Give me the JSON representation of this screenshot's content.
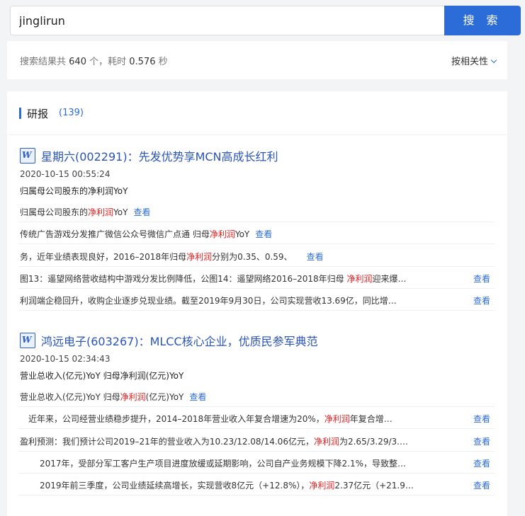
{
  "search": {
    "query": "jinglirun",
    "button_label": "搜 索"
  },
  "summary": {
    "prefix": "搜索结果共",
    "count": "640",
    "unit": "个，耗时",
    "time": "0.576",
    "time_unit": "秒",
    "sort_label": "按相关性"
  },
  "section": {
    "title": "研报",
    "count": "(139)"
  },
  "view_label": "查看",
  "reports": [
    {
      "title": "星期六(002291)：先发优势享MCN高成长红利",
      "date": "2020-10-15 00:55:24",
      "subtitle": "归属母公司股东的净利润YoY",
      "snippets": [
        {
          "before": "归属母公司股东的",
          "hl": "净利润",
          "after": "YoY",
          "indent": "",
          "inline": true
        },
        {
          "before": "传统广告游戏分发推广微信公众号微信广点通 归母",
          "hl": "净利润",
          "after": "YoY",
          "indent": "",
          "inline": true
        },
        {
          "before": "务，近年业绩表现良好，2016–2018年归母",
          "hl": "净利润",
          "after": "分别为0.35、0.59、",
          "indent": "",
          "inline": true
        },
        {
          "before": "图13：遥望网络营收结构中游戏分发比例降低，公图14：遥望网络2016–2018年归母 ",
          "hl": "净利润",
          "after": "迎来爆…",
          "indent": "",
          "inline": false
        },
        {
          "before": "利润端企稳回升，收购企业逐步兑现业绩。截至2019年9月30日，公司实现营收13.69亿，同比增…",
          "hl": "",
          "after": "",
          "indent": "",
          "inline": false
        }
      ]
    },
    {
      "title": "鸿远电子(603267)：MLCC核心企业，优质民参军典范",
      "date": "2020-10-15 02:34:43",
      "subtitle": "营业总收入(亿元)YoY 归母净利润(亿元)YoY",
      "snippets": [
        {
          "before": "营业总收入(亿元)YoY 归母",
          "hl": "净利润",
          "after": "(亿元)YoY",
          "indent": "",
          "inline": true
        },
        {
          "before": "近年来，公司经营业绩稳步提升，2014–2018年营业收入年复合增速为20%，",
          "hl": "净利润",
          "after": "年复合增…",
          "indent": "indent",
          "inline": false
        },
        {
          "before": "盈利预测：我们预计公司2019–21年的营业收入为10.23/12.08/14.06亿元，",
          "hl": "净利润",
          "after": "为2.65/3.29/3.…",
          "indent": "",
          "inline": false
        },
        {
          "before": "2017年，受部分军工客户生产项目进度放缓或延期影响，公司自产业务规模下降2.1%，导致整…",
          "hl": "",
          "after": "",
          "indent": "indent2",
          "inline": false
        },
        {
          "before": "2019年前三季度，公司业绩延续高增长，实现营收8亿元（+12.8%），",
          "hl": "净利润",
          "after": "2.37亿元（+21.9…",
          "indent": "indent2",
          "inline": false
        }
      ]
    }
  ]
}
